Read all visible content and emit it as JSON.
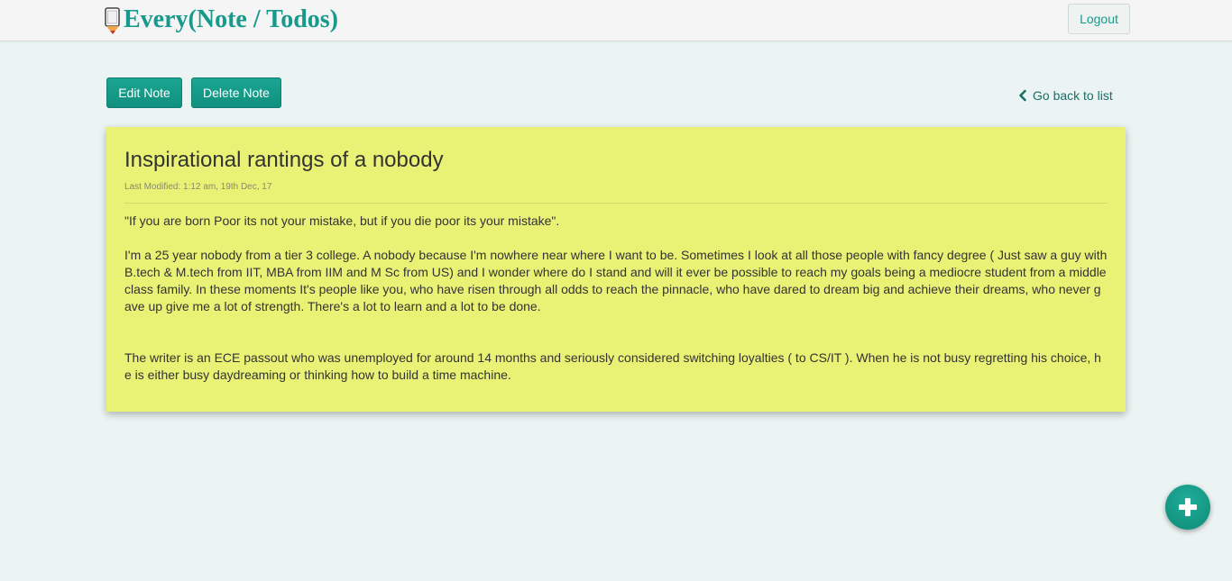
{
  "header": {
    "brand": "Every(Note / Todos)",
    "brand_icon": "notepad-pencil-icon",
    "logout_label": "Logout"
  },
  "toolbar": {
    "edit_label": "Edit Note",
    "delete_label": "Delete Note",
    "back_label": "Go back to list",
    "back_icon": "chevron-left-icon"
  },
  "note": {
    "title": "Inspirational rantings of a nobody",
    "last_modified": "Last Modified: 1:12 am, 19th Dec, 17",
    "paragraphs": [
      "\"If you are born Poor its not your mistake, but if you die poor its your mistake\".",
      "I'm a 25 year nobody from a tier 3 college. A nobody because I'm nowhere near where I want to be. Sometimes I look at all those people with fancy degree ( Just saw a guy with B.tech & M.tech from IIT, MBA from IIM and M Sc from US) and I wonder where do I stand and will it ever be possible to reach my goals being a mediocre student from a middle class family. In these moments It's people like you, who have risen through all odds to reach the pinnacle, who have dared to dream big and achieve their dreams, who never gave up give me a lot of strength. There's a lot to learn and a lot to be done.",
      "The writer is an ECE passout who was unemployed for around 14 months and seriously considered switching loyalties ( to CS/IT ). When he is not busy regretting his choice, he is either busy daydreaming or thinking how to build a time machine."
    ],
    "card_color": "#e9f275"
  },
  "fab": {
    "icon": "plus-icon"
  },
  "colors": {
    "accent": "#17998b",
    "background": "#ebf4f2"
  }
}
